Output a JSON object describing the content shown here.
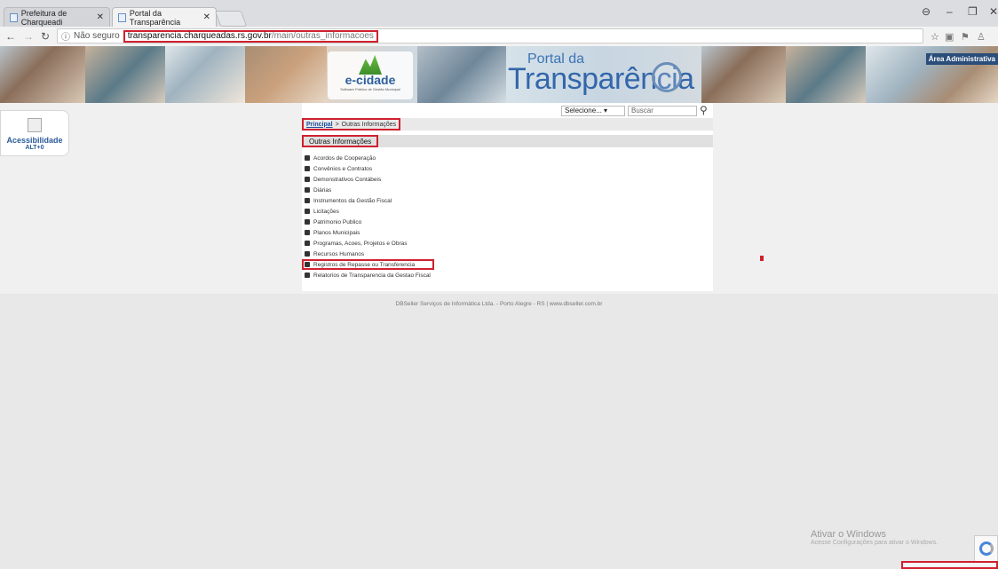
{
  "browser": {
    "tabs": [
      {
        "title": "Prefeitura de Charqueadi"
      },
      {
        "title": "Portal da Transparência"
      }
    ],
    "address": {
      "security_label": "Não seguro",
      "host": "transparencia.charqueadas.rs.gov.br",
      "path": "/main/outras_informacoes"
    }
  },
  "banner": {
    "ecidade_logo": "e-cidade",
    "ecidade_sub": "Software Público de Gestão Municipal",
    "portal_line1": "Portal da",
    "portal_line2": "Transparência",
    "admin_link": "Área Administrativa"
  },
  "accessibility": {
    "title": "Acessibilidade",
    "shortcut": "ALT+0"
  },
  "search": {
    "select_value": "Selecione...",
    "placeholder": "Buscar"
  },
  "breadcrumb": {
    "home": "Principal",
    "separator": ">",
    "current": "Outras Informações"
  },
  "section": {
    "title": "Outras Informações",
    "items": [
      "Acordos de Cooperação",
      "Convênios e Contratos",
      "Demonstrativos Contábeis",
      "Diárias",
      "Instrumentos da Gestão Fiscal",
      "Licitações",
      "Patrimonio Publico",
      "Planos Municipais",
      "Programas, Acoes, Projetos e Obras",
      "Recursos Humanos",
      "Registros de Repasse ou Transferencia",
      "Relatorios de Transparencia da Gestao Fiscal"
    ]
  },
  "footer": {
    "text": "DBSeller Serviços de Informática Ltda. - Porto Alegre - RS | www.dbseller.com.br"
  },
  "windows": {
    "activate_title": "Ativar o Windows",
    "activate_sub": "Acesse Configurações para ativar o Windows."
  },
  "colors": {
    "highlight": "#d0202e",
    "link": "#1e4fa0",
    "brand_blue": "#3366aa"
  }
}
